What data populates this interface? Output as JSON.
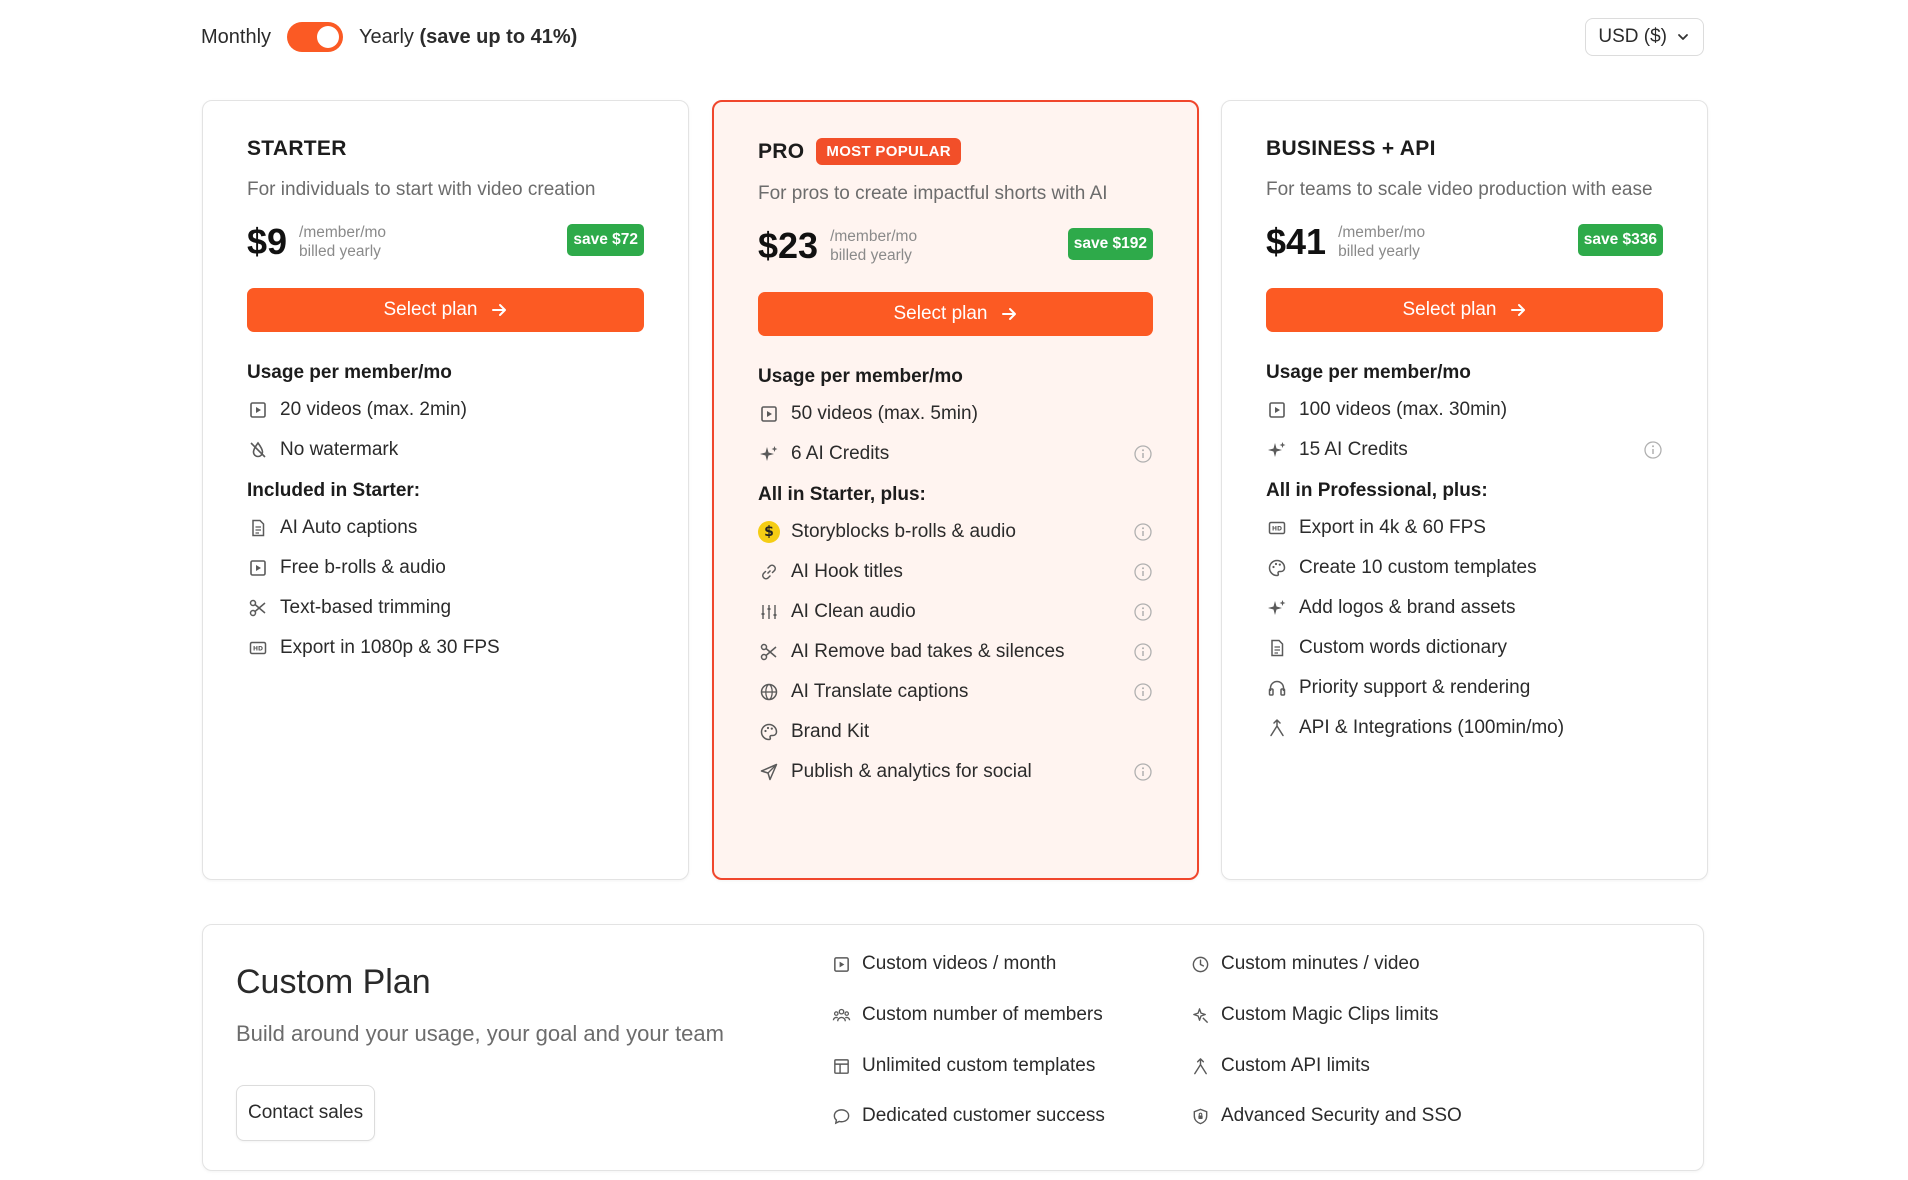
{
  "billing": {
    "monthly_label": "Monthly",
    "yearly_label": "Yearly",
    "yearly_savings": "(save up to 41%)",
    "toggle_state": "yearly"
  },
  "currency": {
    "label": "USD ($)"
  },
  "colors": {
    "accent": "#fc5a23",
    "popular_border": "#f0462c",
    "save_badge": "#2eaa4a",
    "pro_background": "#fff4f0"
  },
  "plans": {
    "starter": {
      "name": "STARTER",
      "description": "For individuals to start with video creation",
      "price": "$9",
      "price_unit": "/member/mo",
      "billing_note": "billed yearly",
      "save": "save $72",
      "cta": "Select plan",
      "usage_title": "Usage per member/mo",
      "usage": [
        {
          "icon": "play-square-icon",
          "text": "20 videos (max. 2min)"
        },
        {
          "icon": "no-watermark-icon",
          "text": "No watermark"
        }
      ],
      "included_title": "Included in Starter:",
      "included": [
        {
          "icon": "document-icon",
          "text": "AI Auto captions"
        },
        {
          "icon": "play-square-icon",
          "text": "Free b-rolls & audio"
        },
        {
          "icon": "scissors-icon",
          "text": "Text-based trimming"
        },
        {
          "icon": "hd-icon",
          "text": "Export in 1080p & 30 FPS"
        }
      ]
    },
    "pro": {
      "name": "PRO",
      "badge": "MOST POPULAR",
      "description": "For pros to create impactful shorts with AI",
      "price": "$23",
      "price_unit": "/member/mo",
      "billing_note": "billed yearly",
      "save": "save $192",
      "cta": "Select plan",
      "usage_title": "Usage per member/mo",
      "usage": [
        {
          "icon": "play-square-icon",
          "text": "50 videos (max. 5min)"
        },
        {
          "icon": "sparkles-icon",
          "text": "6 AI Credits",
          "info": true
        }
      ],
      "included_title": "All in Starter, plus:",
      "included": [
        {
          "icon": "storyblocks-icon",
          "text": "Storyblocks b-rolls & audio",
          "info": true
        },
        {
          "icon": "link-icon",
          "text": "AI Hook titles",
          "info": true
        },
        {
          "icon": "sliders-icon",
          "text": "AI Clean audio",
          "info": true
        },
        {
          "icon": "scissors-icon",
          "text": "AI Remove bad takes & silences",
          "info": true
        },
        {
          "icon": "globe-icon",
          "text": "AI Translate captions",
          "info": true
        },
        {
          "icon": "palette-icon",
          "text": "Brand Kit"
        },
        {
          "icon": "send-icon",
          "text": "Publish & analytics for social",
          "info": true
        }
      ]
    },
    "business": {
      "name": "BUSINESS + API",
      "description": "For teams to scale video production with ease",
      "price": "$41",
      "price_unit": "/member/mo",
      "billing_note": "billed yearly",
      "save": "save $336",
      "cta": "Select plan",
      "usage_title": "Usage per member/mo",
      "usage": [
        {
          "icon": "play-square-icon",
          "text": "100 videos (max. 30min)"
        },
        {
          "icon": "sparkles-icon",
          "text": "15 AI Credits",
          "info": true
        }
      ],
      "included_title": "All in Professional, plus:",
      "included": [
        {
          "icon": "hd-icon",
          "text": "Export in 4k & 60 FPS"
        },
        {
          "icon": "palette-icon",
          "text": "Create 10 custom templates"
        },
        {
          "icon": "sparkles-icon",
          "text": "Add logos & brand assets"
        },
        {
          "icon": "document-icon",
          "text": "Custom words dictionary"
        },
        {
          "icon": "headphones-icon",
          "text": "Priority support & rendering"
        },
        {
          "icon": "merge-icon",
          "text": "API & Integrations (100min/mo)"
        }
      ]
    }
  },
  "custom_plan": {
    "title": "Custom Plan",
    "subtitle": "Build around your usage, your goal and your team",
    "cta": "Contact sales",
    "features_left": [
      {
        "icon": "play-square-icon",
        "text": "Custom videos / month"
      },
      {
        "icon": "users-icon",
        "text": "Custom number of members"
      },
      {
        "icon": "layout-icon",
        "text": "Unlimited custom templates"
      },
      {
        "icon": "chat-icon",
        "text": "Dedicated customer success"
      }
    ],
    "features_right": [
      {
        "icon": "clock-icon",
        "text": "Custom minutes / video"
      },
      {
        "icon": "magic-icon",
        "text": "Custom Magic Clips limits"
      },
      {
        "icon": "merge-icon",
        "text": "Custom API limits"
      },
      {
        "icon": "shield-icon",
        "text": "Advanced Security and SSO"
      }
    ]
  }
}
